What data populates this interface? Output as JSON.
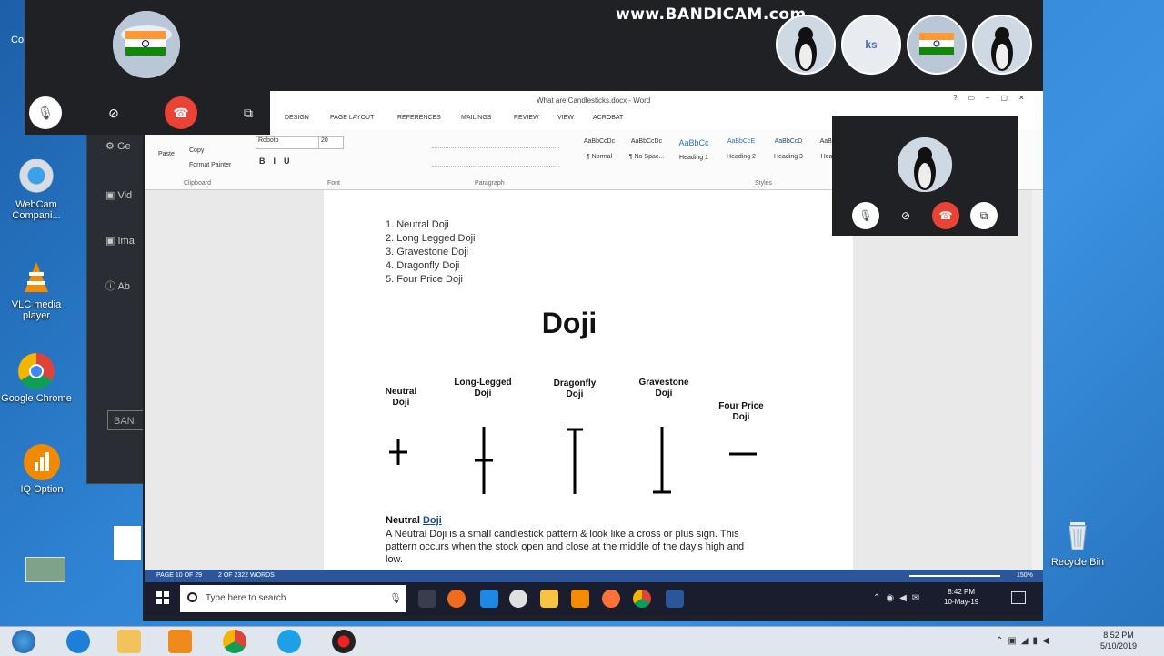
{
  "recording_watermark": "www.BANDICAM.com",
  "desktop": {
    "icons": [
      {
        "label": "WebCam Compani...",
        "icon": "webcam-icon"
      },
      {
        "label": "VLC media player",
        "icon": "vlc-icon"
      },
      {
        "label": "Google Chrome",
        "icon": "chrome-icon"
      },
      {
        "label": "IQ Option",
        "icon": "iqoption-icon"
      },
      {
        "label": "Recycle Bin",
        "icon": "recycle-bin-icon"
      }
    ],
    "partial_left_text": "Co",
    "bandicam_items": [
      "Ge",
      "Vid",
      "Ima",
      "Ab"
    ],
    "bandicam_button": "BAN"
  },
  "call": {
    "participant_initials": "ks",
    "participants": [
      "india-flag-avatar",
      "penguin-avatar",
      "ks",
      "india-flag-avatar",
      "penguin-avatar"
    ]
  },
  "word": {
    "title": "What are Candlesticks.docx - Word",
    "tabs": [
      "DESIGN",
      "PAGE LAYOUT",
      "REFERENCES",
      "MAILINGS",
      "REVIEW",
      "VIEW",
      "ACROBAT"
    ],
    "clipboard": {
      "paste": "Paste",
      "copy": "Copy",
      "format_painter": "Format Painter",
      "group": "Clipboard"
    },
    "font": {
      "name": "Roboto",
      "size": "20",
      "group": "Font"
    },
    "paragraph_group": "Paragraph",
    "styles_group": "Styles",
    "styles": [
      {
        "sample": "AaBbCcDc",
        "name": "¶ Normal"
      },
      {
        "sample": "AaBbCcDc",
        "name": "¶ No Spac..."
      },
      {
        "sample": "AaBbCc",
        "name": "Heading 1"
      },
      {
        "sample": "AaBbCcE",
        "name": "Heading 2"
      },
      {
        "sample": "AaBbCcD",
        "name": "Heading 3"
      },
      {
        "sample": "AaBl",
        "name": "Hea"
      }
    ],
    "doc": {
      "list": [
        "1. Neutral Doji",
        "2. Long Legged Doji",
        "3. Gravestone Doji",
        "4. Dragonfly Doji",
        "5. Four Price Doji"
      ],
      "heading": "Doji",
      "candles": [
        {
          "label": "Neutral Doji",
          "shape": "neutral"
        },
        {
          "label": "Long-Legged Doji",
          "shape": "long-legged"
        },
        {
          "label": "Dragonfly Doji",
          "shape": "dragonfly"
        },
        {
          "label": "Gravestone Doji",
          "shape": "gravestone"
        },
        {
          "label": "Four Price Doji",
          "shape": "four-price"
        }
      ],
      "section_title_a": "Neutral ",
      "section_title_b": "Doji",
      "para_line1": "A Neutral Doji is a small candlestick pattern & look like a cross or plus sign. This",
      "para_line2": "pattern occurs when the stock open and close at the middle of the day's high and",
      "para_line3": "low."
    },
    "status": {
      "page": "PAGE 10 OF 29",
      "words": "2 OF 2322 WORDS",
      "zoom": "150%"
    }
  },
  "remote_taskbar": {
    "search_placeholder": "Type here to search",
    "time": "8:42 PM",
    "date": "10-May-19"
  },
  "local_taskbar": {
    "time": "8:52 PM",
    "date": "5/10/2019"
  },
  "colors": {
    "word_blue": "#2b579a",
    "end_call_red": "#ea4335",
    "call_bg": "#202124"
  }
}
